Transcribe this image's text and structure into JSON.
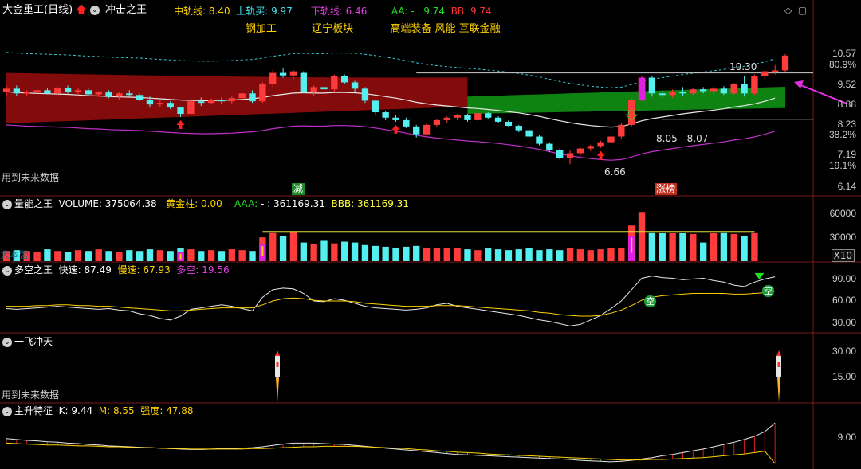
{
  "header": {
    "title": "大金重工(日线)",
    "indicator_name": "冲击之王",
    "fields": [
      {
        "label": "中轨线",
        "value": "8.40",
        "color": "#ffd200"
      },
      {
        "label": "上轨买",
        "value": "9.97",
        "color": "#44e5f0"
      },
      {
        "label": "下轨线",
        "value": "6.46",
        "color": "#e040e0"
      },
      {
        "label": "AA",
        "value": "- : 9.74",
        "color": "#22dd22"
      },
      {
        "label": "BB",
        "value": "9.74",
        "color": "#ff3030"
      }
    ],
    "tags": [
      "钢加工",
      "辽宁板块",
      "高端装备",
      "风能",
      "互联金融"
    ]
  },
  "panels": {
    "main": {
      "future_note": "用到未来数据",
      "axis_labels": [
        "10.57",
        "80.9%",
        "9.52",
        "8.88",
        "8.23",
        "38.2%",
        "7.19",
        "19.1%",
        "6.14"
      ],
      "annotations": {
        "high": "10.30",
        "low": "6.66",
        "range": "8.05 - 8.07"
      },
      "badges": {
        "reduce": "减",
        "limit_up": "涨榜"
      }
    },
    "volume": {
      "name": "量能之王",
      "volume_label": "VOLUME",
      "volume_value": "375064.38",
      "gold_label": "黄金柱",
      "gold_value": "0.00",
      "aaa_label": "AAA",
      "aaa_value": "- : 361169.31",
      "bbb_label": "BBB",
      "bbb_value": "361169.31",
      "axis_labels": [
        "60000",
        "30000"
      ],
      "unit": "X10",
      "overlay_text": "大本营"
    },
    "duokong": {
      "name": "多空之王",
      "fast_label": "快速",
      "fast_value": "87.49",
      "slow_label": "慢速",
      "slow_value": "67.93",
      "dk_label": "多空",
      "dk_value": "19.56",
      "axis_labels": [
        "90.00",
        "60.00",
        "30.00"
      ],
      "marks": [
        "空",
        "空"
      ]
    },
    "yifei": {
      "name": "一飞冲天",
      "future_note": "用到未来数据",
      "axis_labels": [
        "30.00",
        "15.00"
      ]
    },
    "zhusheng": {
      "name": "主升特征",
      "k_label": "K",
      "k_value": "9.44",
      "m_label": "M",
      "m_value": "8.55",
      "strength_label": "强度",
      "strength_value": "47.88",
      "axis_labels": [
        "9.00"
      ]
    }
  },
  "chart_data": {
    "type": "candlestick",
    "y_range": [
      6.0,
      10.7
    ],
    "candles": [
      {
        "o": 9.1,
        "h": 9.3,
        "l": 8.95,
        "c": 9.2
      },
      {
        "o": 9.2,
        "h": 9.3,
        "l": 8.98,
        "c": 9.05
      },
      {
        "o": 9.05,
        "h": 9.15,
        "l": 8.98,
        "c": 9.08
      },
      {
        "o": 9.08,
        "h": 9.2,
        "l": 8.95,
        "c": 9.15
      },
      {
        "o": 9.15,
        "h": 9.22,
        "l": 9.02,
        "c": 9.05
      },
      {
        "o": 9.05,
        "h": 9.25,
        "l": 9.0,
        "c": 9.22
      },
      {
        "o": 9.22,
        "h": 9.3,
        "l": 9.05,
        "c": 9.1
      },
      {
        "o": 9.1,
        "h": 9.22,
        "l": 9.0,
        "c": 9.15
      },
      {
        "o": 9.15,
        "h": 9.2,
        "l": 8.98,
        "c": 9.02
      },
      {
        "o": 9.02,
        "h": 9.12,
        "l": 8.95,
        "c": 9.08
      },
      {
        "o": 9.08,
        "h": 9.15,
        "l": 8.9,
        "c": 8.95
      },
      {
        "o": 8.95,
        "h": 9.1,
        "l": 8.85,
        "c": 9.05
      },
      {
        "o": 9.05,
        "h": 9.15,
        "l": 8.95,
        "c": 9.0
      },
      {
        "o": 9.0,
        "h": 9.05,
        "l": 8.8,
        "c": 8.85
      },
      {
        "o": 8.85,
        "h": 8.95,
        "l": 8.6,
        "c": 8.7
      },
      {
        "o": 8.7,
        "h": 8.82,
        "l": 8.62,
        "c": 8.75
      },
      {
        "o": 8.75,
        "h": 8.8,
        "l": 8.55,
        "c": 8.6
      },
      {
        "o": 8.6,
        "h": 8.62,
        "l": 8.3,
        "c": 8.4
      },
      {
        "o": 8.4,
        "h": 8.85,
        "l": 8.35,
        "c": 8.8
      },
      {
        "o": 8.8,
        "h": 8.92,
        "l": 8.65,
        "c": 8.75
      },
      {
        "o": 8.75,
        "h": 8.9,
        "l": 8.7,
        "c": 8.85
      },
      {
        "o": 8.85,
        "h": 8.92,
        "l": 8.7,
        "c": 8.8
      },
      {
        "o": 8.8,
        "h": 8.95,
        "l": 8.72,
        "c": 8.9
      },
      {
        "o": 8.9,
        "h": 9.08,
        "l": 8.85,
        "c": 9.05
      },
      {
        "o": 9.05,
        "h": 9.15,
        "l": 8.75,
        "c": 8.8
      },
      {
        "o": 8.8,
        "h": 9.4,
        "l": 8.75,
        "c": 9.35
      },
      {
        "o": 9.35,
        "h": 9.8,
        "l": 9.25,
        "c": 9.7
      },
      {
        "o": 9.7,
        "h": 9.85,
        "l": 9.55,
        "c": 9.62
      },
      {
        "o": 9.62,
        "h": 9.8,
        "l": 9.5,
        "c": 9.75
      },
      {
        "o": 9.7,
        "h": 9.75,
        "l": 9.05,
        "c": 9.1
      },
      {
        "o": 9.1,
        "h": 9.3,
        "l": 8.95,
        "c": 9.25
      },
      {
        "o": 9.25,
        "h": 9.35,
        "l": 9.12,
        "c": 9.18
      },
      {
        "o": 9.18,
        "h": 9.65,
        "l": 9.1,
        "c": 9.6
      },
      {
        "o": 9.6,
        "h": 9.65,
        "l": 9.35,
        "c": 9.4
      },
      {
        "o": 9.4,
        "h": 9.45,
        "l": 9.1,
        "c": 9.2
      },
      {
        "o": 9.2,
        "h": 9.25,
        "l": 8.75,
        "c": 8.82
      },
      {
        "o": 8.82,
        "h": 8.85,
        "l": 8.35,
        "c": 8.45
      },
      {
        "o": 8.45,
        "h": 8.48,
        "l": 8.2,
        "c": 8.28
      },
      {
        "o": 8.28,
        "h": 8.35,
        "l": 8.15,
        "c": 8.2
      },
      {
        "o": 8.2,
        "h": 8.28,
        "l": 7.95,
        "c": 8.0
      },
      {
        "o": 8.0,
        "h": 8.05,
        "l": 7.65,
        "c": 7.75
      },
      {
        "o": 7.75,
        "h": 8.1,
        "l": 7.7,
        "c": 8.05
      },
      {
        "o": 8.05,
        "h": 8.25,
        "l": 8.0,
        "c": 8.2
      },
      {
        "o": 8.2,
        "h": 8.32,
        "l": 8.12,
        "c": 8.28
      },
      {
        "o": 8.28,
        "h": 8.4,
        "l": 8.2,
        "c": 8.35
      },
      {
        "o": 8.35,
        "h": 8.4,
        "l": 8.15,
        "c": 8.2
      },
      {
        "o": 8.2,
        "h": 8.45,
        "l": 8.15,
        "c": 8.42
      },
      {
        "o": 8.42,
        "h": 8.45,
        "l": 8.22,
        "c": 8.28
      },
      {
        "o": 8.28,
        "h": 8.32,
        "l": 8.1,
        "c": 8.15
      },
      {
        "o": 8.15,
        "h": 8.2,
        "l": 7.98,
        "c": 8.02
      },
      {
        "o": 8.02,
        "h": 8.05,
        "l": 7.82,
        "c": 7.88
      },
      {
        "o": 7.88,
        "h": 7.92,
        "l": 7.62,
        "c": 7.68
      },
      {
        "o": 7.68,
        "h": 7.72,
        "l": 7.4,
        "c": 7.45
      },
      {
        "o": 7.45,
        "h": 7.5,
        "l": 7.2,
        "c": 7.25
      },
      {
        "o": 7.25,
        "h": 7.3,
        "l": 6.95,
        "c": 7.0
      },
      {
        "o": 7.0,
        "h": 7.25,
        "l": 6.8,
        "c": 7.15
      },
      {
        "o": 7.15,
        "h": 7.35,
        "l": 7.05,
        "c": 7.3
      },
      {
        "o": 7.3,
        "h": 7.42,
        "l": 7.22,
        "c": 7.38
      },
      {
        "o": 7.38,
        "h": 7.55,
        "l": 7.32,
        "c": 7.5
      },
      {
        "o": 7.5,
        "h": 7.72,
        "l": 7.45,
        "c": 7.68
      },
      {
        "o": 7.68,
        "h": 8.1,
        "l": 7.62,
        "c": 8.05
      },
      {
        "o": 8.05,
        "h": 8.9,
        "l": 8.0,
        "c": 8.85
      },
      {
        "o": 8.85,
        "h": 9.62,
        "l": 8.8,
        "c": 9.55
      },
      {
        "o": 9.55,
        "h": 9.6,
        "l": 8.95,
        "c": 9.05
      },
      {
        "o": 9.05,
        "h": 9.15,
        "l": 8.9,
        "c": 9.0
      },
      {
        "o": 9.0,
        "h": 9.18,
        "l": 8.92,
        "c": 9.1
      },
      {
        "o": 9.1,
        "h": 9.25,
        "l": 8.98,
        "c": 9.05
      },
      {
        "o": 9.05,
        "h": 9.22,
        "l": 9.0,
        "c": 9.18
      },
      {
        "o": 9.18,
        "h": 9.25,
        "l": 9.05,
        "c": 9.12
      },
      {
        "o": 9.12,
        "h": 9.25,
        "l": 9.02,
        "c": 9.2
      },
      {
        "o": 9.2,
        "h": 9.28,
        "l": 9.0,
        "c": 9.05
      },
      {
        "o": 9.05,
        "h": 9.38,
        "l": 9.0,
        "c": 9.35
      },
      {
        "o": 9.35,
        "h": 9.6,
        "l": 8.95,
        "c": 9.05
      },
      {
        "o": 9.05,
        "h": 9.65,
        "l": 9.0,
        "c": 9.6
      },
      {
        "o": 9.6,
        "h": 9.8,
        "l": 9.5,
        "c": 9.75
      },
      {
        "o": 9.75,
        "h": 9.95,
        "l": 9.65,
        "c": 9.78
      },
      {
        "o": 9.78,
        "h": 10.3,
        "l": 9.72,
        "c": 10.25
      }
    ],
    "volume_values": [
      12,
      13,
      12,
      11,
      14,
      12,
      11,
      13,
      12,
      14,
      12,
      11,
      13,
      12,
      14,
      13,
      12,
      15,
      14,
      12,
      13,
      12,
      14,
      13,
      12,
      28,
      34,
      30,
      35,
      22,
      20,
      24,
      21,
      23,
      22,
      19,
      18,
      17,
      16,
      17,
      18,
      16,
      15,
      16,
      15,
      14,
      13,
      15,
      14,
      13,
      14,
      15,
      13,
      14,
      13,
      15,
      14,
      13,
      14,
      15,
      16,
      42,
      58,
      34,
      33,
      33,
      33,
      32,
      22,
      33,
      34,
      32,
      30,
      34
    ],
    "fast_values": [
      45,
      44,
      45,
      46,
      47,
      48,
      47,
      46,
      45,
      44,
      45,
      43,
      42,
      38,
      36,
      32,
      30,
      35,
      44,
      46,
      48,
      50,
      48,
      45,
      42,
      60,
      70,
      72,
      71,
      65,
      55,
      54,
      58,
      56,
      52,
      48,
      46,
      45,
      44,
      43,
      44,
      46,
      50,
      52,
      48,
      46,
      44,
      42,
      40,
      38,
      36,
      33,
      30,
      28,
      25,
      22,
      24,
      30,
      36,
      45,
      55,
      70,
      85,
      88,
      86,
      85,
      83,
      84,
      85,
      82,
      80,
      76,
      74,
      80,
      84,
      87
    ],
    "slow_values": [
      48,
      48,
      48,
      49,
      49,
      50,
      50,
      49,
      49,
      48,
      48,
      47,
      46,
      45,
      44,
      43,
      42,
      42,
      43,
      44,
      45,
      46,
      46,
      46,
      46,
      50,
      55,
      58,
      59,
      58,
      56,
      55,
      55,
      55,
      54,
      52,
      51,
      50,
      49,
      48,
      48,
      48,
      49,
      49,
      49,
      48,
      47,
      46,
      45,
      44,
      43,
      42,
      40,
      39,
      37,
      36,
      35,
      35,
      36,
      39,
      43,
      49,
      56,
      60,
      62,
      63,
      64,
      65,
      65,
      65,
      65,
      64,
      64,
      65,
      66,
      68
    ],
    "ema_values": [
      9.1,
      9.08,
      9.06,
      9.05,
      9.04,
      9.03,
      9.02,
      9.0,
      8.98,
      8.97,
      8.95,
      8.94,
      8.93,
      8.92,
      8.9,
      8.88,
      8.86,
      8.84,
      8.83,
      8.82,
      8.82,
      8.83,
      8.84,
      8.86,
      8.88,
      8.92,
      8.98,
      9.02,
      9.06,
      9.07,
      9.06,
      9.06,
      9.08,
      9.08,
      9.07,
      9.04,
      9.0,
      8.95,
      8.9,
      8.84,
      8.77,
      8.72,
      8.68,
      8.65,
      8.62,
      8.59,
      8.57,
      8.54,
      8.51,
      8.47,
      8.43,
      8.38,
      8.32,
      8.25,
      8.18,
      8.12,
      8.07,
      8.03,
      8.0,
      7.98,
      8.0,
      8.08,
      8.18,
      8.25,
      8.3,
      8.35,
      8.4,
      8.44,
      8.48,
      8.52,
      8.56,
      8.62,
      8.66,
      8.72,
      8.8,
      8.9
    ],
    "zhusheng_k": [
      9.1,
      9.08,
      9.06,
      9.05,
      9.03,
      9.02,
      9.0,
      8.99,
      8.97,
      8.96,
      8.94,
      8.93,
      8.92,
      8.91,
      8.9,
      8.89,
      8.88,
      8.87,
      8.86,
      8.86,
      8.87,
      8.88,
      8.88,
      8.89,
      8.9,
      8.92,
      8.95,
      8.98,
      9.0,
      9.0,
      9.0,
      8.99,
      8.98,
      8.97,
      8.95,
      8.93,
      8.91,
      8.89,
      8.87,
      8.85,
      8.83,
      8.81,
      8.79,
      8.77,
      8.75,
      8.74,
      8.73,
      8.72,
      8.71,
      8.7,
      8.69,
      8.68,
      8.67,
      8.66,
      8.65,
      8.64,
      8.62,
      8.61,
      8.6,
      8.59,
      8.6,
      8.62,
      8.65,
      8.68,
      8.72,
      8.75,
      8.79,
      8.83,
      8.87,
      8.92,
      8.97,
      9.02,
      9.08,
      9.15,
      9.25,
      9.44
    ],
    "zhusheng_m": [
      9.0,
      8.99,
      8.98,
      8.97,
      8.96,
      8.96,
      8.95,
      8.94,
      8.94,
      8.93,
      8.92,
      8.92,
      8.91,
      8.9,
      8.9,
      8.89,
      8.88,
      8.88,
      8.87,
      8.87,
      8.87,
      8.87,
      8.87,
      8.87,
      8.88,
      8.88,
      8.89,
      8.9,
      8.91,
      8.92,
      8.92,
      8.93,
      8.93,
      8.93,
      8.93,
      8.92,
      8.91,
      8.9,
      8.89,
      8.88,
      8.86,
      8.85,
      8.83,
      8.82,
      8.8,
      8.79,
      8.78,
      8.76,
      8.75,
      8.74,
      8.73,
      8.72,
      8.71,
      8.7,
      8.69,
      8.68,
      8.67,
      8.66,
      8.65,
      8.64,
      8.63,
      8.63,
      8.63,
      8.64,
      8.64,
      8.65,
      8.66,
      8.67,
      8.68,
      8.7,
      8.72,
      8.74,
      8.76,
      8.79,
      8.82,
      8.55
    ]
  }
}
